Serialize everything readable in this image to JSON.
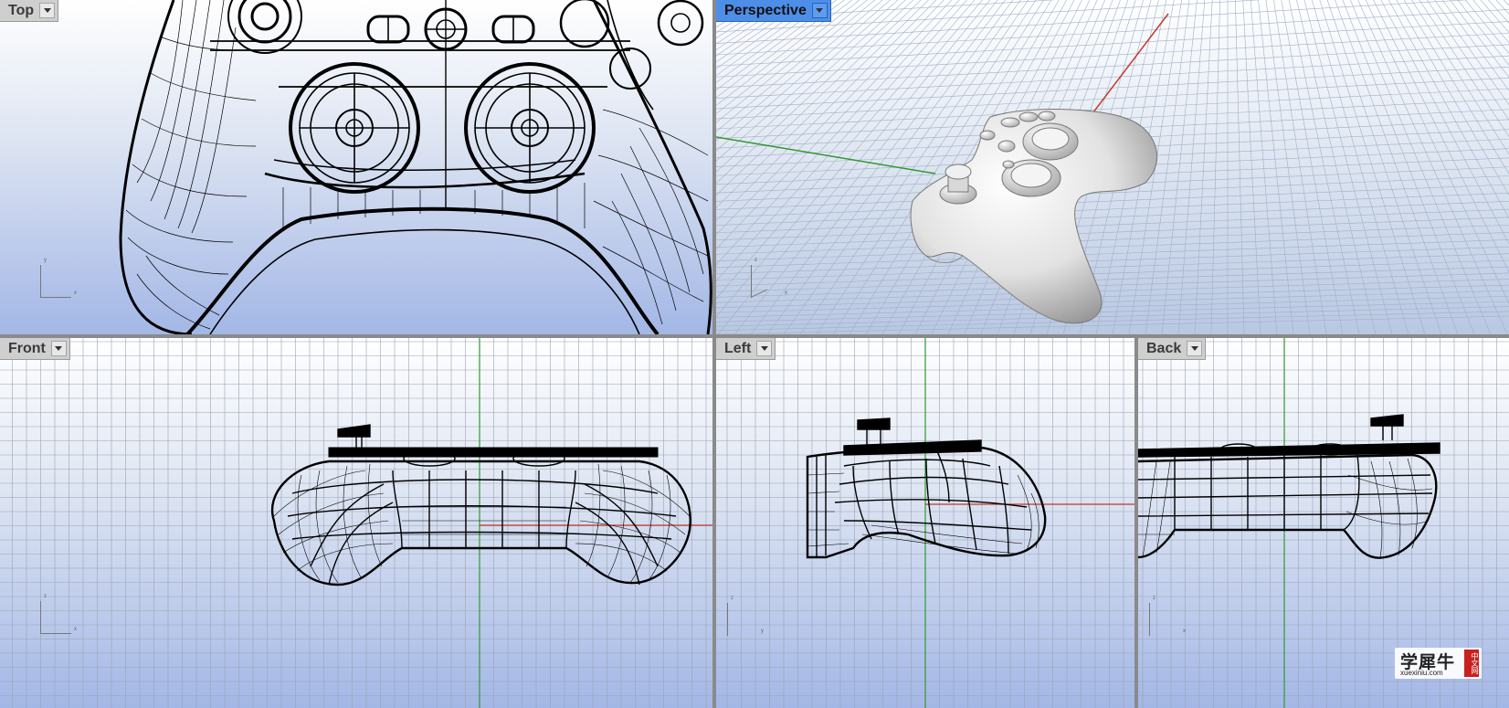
{
  "viewports": {
    "top": {
      "label": "Top",
      "axis_y": "y",
      "axis_x": "x"
    },
    "perspective": {
      "label": "Perspective",
      "axis_y": "z",
      "axis_x": "x"
    },
    "front": {
      "label": "Front",
      "axis_y": "z",
      "axis_x": "x"
    },
    "left": {
      "label": "Left",
      "axis_y": "z",
      "axis_x": "y"
    },
    "back": {
      "label": "Back",
      "axis_y": "z",
      "axis_x": "x"
    }
  },
  "icons": {
    "menu": "chevron-down-icon",
    "axes": "axis-triad-icon"
  },
  "colors": {
    "active_tab": "#4d8ee8",
    "x_axis": "#c0392b",
    "y_axis": "#2e9a2e",
    "grid": "#9aa3b2",
    "wire": "#000000"
  },
  "watermark": {
    "brand": "学犀牛",
    "url": "xuexiniu.com",
    "seal": "中文网"
  }
}
